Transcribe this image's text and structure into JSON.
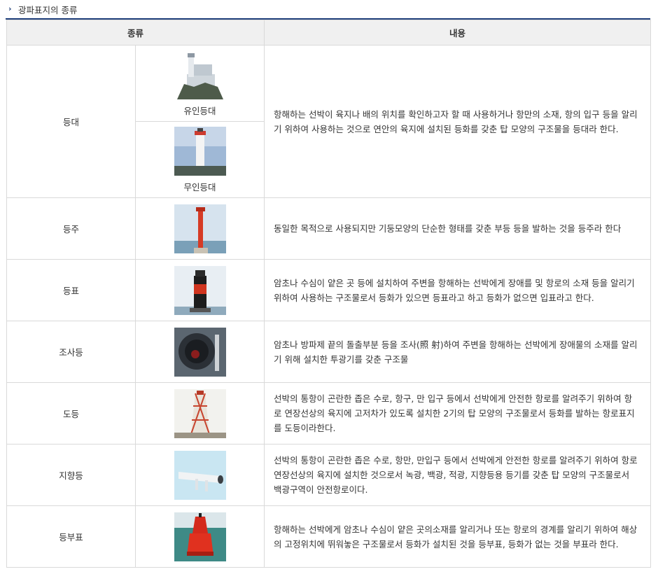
{
  "section": {
    "title": "광파표지의 종류",
    "arrow_icon": "chevron-right-icon"
  },
  "table": {
    "headers": {
      "kind": "종류",
      "content": "내용"
    },
    "rows": [
      {
        "kind": "등대",
        "images": [
          {
            "icon": "manned-lighthouse-icon",
            "caption": "유인등대"
          },
          {
            "icon": "unmanned-lighthouse-icon",
            "caption": "무인등대"
          }
        ],
        "desc": "항해하는 선박이 육지나 배의 위치를 확인하고자 할 때 사용하거나 항만의 소재, 항의 입구 등을 알리기 위하여 사용하는 것으로 연안의 육지에 설치된 등화를 갖춘 탑 모양의 구조물을 등대라 한다."
      },
      {
        "kind": "등주",
        "image_icon": "light-pole-icon",
        "desc": "동일한 목적으로 사용되지만 기둥모양의 단순한 형태를 갖춘 부등 등을 발하는 것을 등주라 한다"
      },
      {
        "kind": "등표",
        "image_icon": "light-beacon-icon",
        "desc": "암초나 수심이 얕은 곳 등에 설치하여 주변을 항해하는 선박에게 장애를 및 항로의 소재 등을 알리기 위하여 사용하는 구조물로서 등화가 있으면 등표라고 하고 등화가 없으면 입표라고 한다."
      },
      {
        "kind": "조사등",
        "image_icon": "searchlight-icon",
        "desc": "암초나 방파제 끝의 돌출부분 등을 조사(照 射)하여 주변을 항해하는 선박에게 장애물의 소재를 알리기 위해 설치한 투광기를 갖춘 구조물"
      },
      {
        "kind": "도등",
        "image_icon": "leading-light-icon",
        "desc": "선박의 통항이 곤란한 좁은 수로, 항구, 만 입구 등에서 선박에게 안전한 항로를 알려주기 위하여 항로 연장선상의 육지에 고저차가 있도록 설치한 2기의 탑 모양의 구조물로서 등화를 발하는 항로표지를 도등이라한다."
      },
      {
        "kind": "지향등",
        "image_icon": "directional-light-icon",
        "desc": "선박의 통항이 곤란한 좁은 수로, 항만, 만입구 등에서 선박에게 안전한 항로를 알려주기 위하여 항로 연장선상의 육지에 설치한 것으로서 녹광, 백광, 적광, 지향등용 등기를 갖춘 탑 모양의 구조물로서 백광구역이 안전항로이다."
      },
      {
        "kind": "등부표",
        "image_icon": "light-buoy-icon",
        "desc": "항해하는 선박에게 암초나 수심이 얕은 곳의소재를 알리거나 또는 항로의 경계를 알리기 위하여 해상의 고정위치에 뛰워놓은 구조물로서 등화가 설치된 것을 등부표, 등화가 없는 것을 부표라 한다."
      }
    ]
  },
  "colors": {
    "header_bg": "#f0f0f0",
    "border": "#d9d9d9",
    "accent_navy": "#1f3f7a"
  }
}
